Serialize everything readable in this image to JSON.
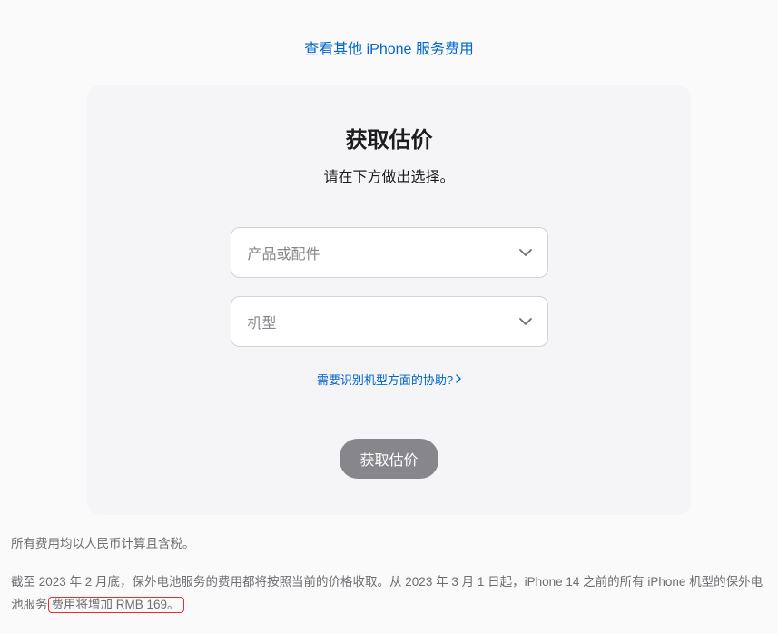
{
  "top_link": "查看其他 iPhone 服务费用",
  "card": {
    "title": "获取估价",
    "subtitle": "请在下方做出选择。",
    "select_product_placeholder": "产品或配件",
    "select_model_placeholder": "机型",
    "help_link": "需要识别机型方面的协助?",
    "button": "获取估价"
  },
  "footer": {
    "p1": "所有费用均以人民币计算且含税。",
    "p2_part1": "截至 2023 年 2 月底，保外电池服务的费用都将按照当前的价格收取。从 2023 年 3 月 1 日起，iPhone 14 之前的所有 iPhone 机型的保外电池服务",
    "p2_highlight": "费用将增加 RMB 169。"
  }
}
